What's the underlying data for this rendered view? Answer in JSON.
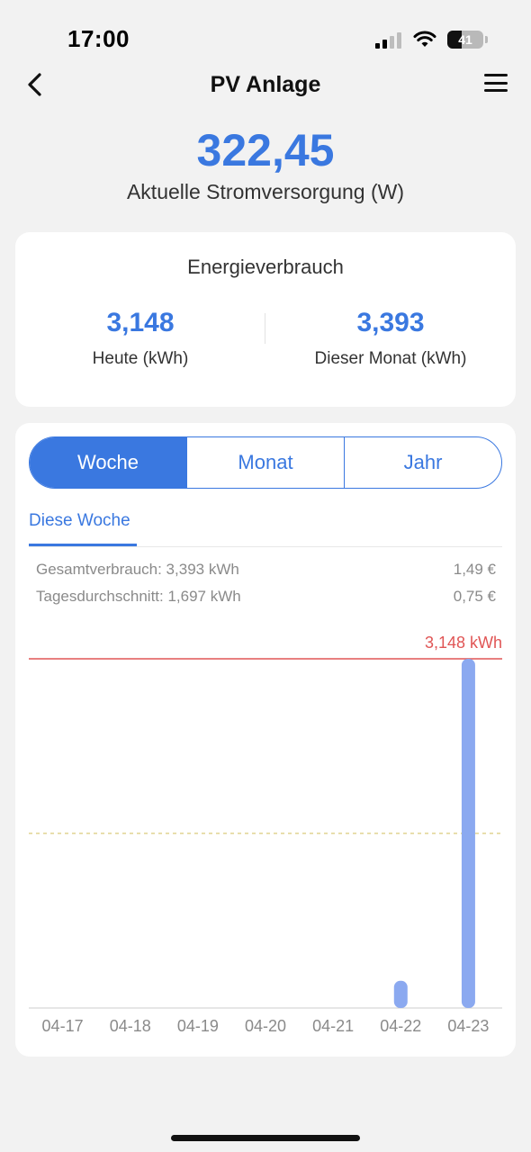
{
  "status_bar": {
    "time": "17:00",
    "battery": "41",
    "icons": [
      "cellular-signal-icon",
      "wifi-icon",
      "battery-icon"
    ]
  },
  "nav": {
    "title": "PV Anlage",
    "back_icon": "chevron-left-icon",
    "menu_icon": "hamburger-menu-icon"
  },
  "hero": {
    "value": "322,45",
    "label": "Aktuelle Stromversorgung (W)"
  },
  "energy_card": {
    "title": "Energieverbrauch",
    "today": {
      "value": "3,148",
      "label": "Heute (kWh)"
    },
    "month": {
      "value": "3,393",
      "label": "Dieser Monat (kWh)"
    }
  },
  "period_tabs": {
    "selected": "Woche",
    "items": [
      "Woche",
      "Monat",
      "Jahr"
    ]
  },
  "subtab": {
    "label": "Diese Woche"
  },
  "summary": {
    "total_label": "Gesamtverbrauch: 3,393 kWh",
    "total_cost": "1,49 €",
    "avg_label": "Tagesdurchschnitt: 1,697 kWh",
    "avg_cost": "0,75 €"
  },
  "chart_data": {
    "type": "bar",
    "categories": [
      "04-17",
      "04-18",
      "04-19",
      "04-20",
      "04-21",
      "04-22",
      "04-23"
    ],
    "values": [
      0,
      0,
      0,
      0,
      0,
      0.245,
      3.148
    ],
    "unit": "kWh",
    "max_line": {
      "value": 3.148,
      "label": "3,148 kWh"
    },
    "avg_line_value": 1.574,
    "ylim": [
      0,
      3.148
    ],
    "grid": false,
    "colors": {
      "bar": "#8ba9f0",
      "max_line": "#e05555",
      "avg_line": "#d9c97a",
      "axis": "#cccccc",
      "tick_text": "#8a8a8a"
    }
  },
  "colors": {
    "accent": "#3a78e0",
    "background": "#f2f2f2",
    "card": "#ffffff"
  }
}
